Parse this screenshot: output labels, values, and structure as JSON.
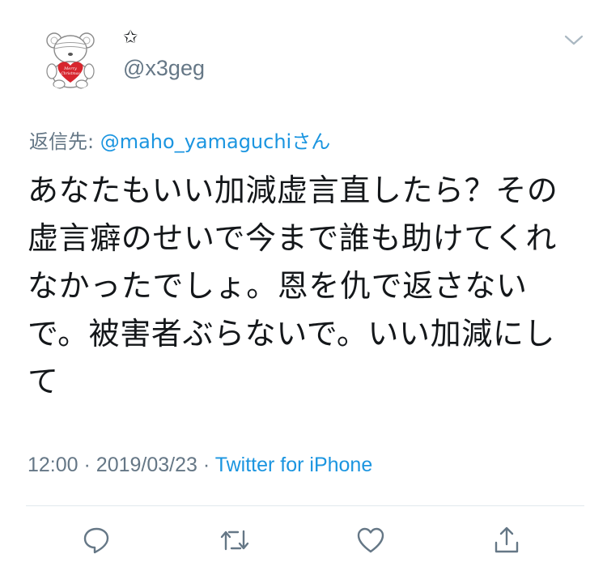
{
  "tweet": {
    "display_name": "✩",
    "handle": "@x3geg",
    "reply_prefix": "返信先: ",
    "reply_mention": "@maho_yamaguchi",
    "reply_suffix": "さん",
    "text": "あなたもいい加減虚言直したら？その虚言癖のせいで今まで誰も助けてくれなかったでしょ。恩を仇で返さないで。被害者ぶらないで。いい加減にして",
    "time": "12:00",
    "separator": "·",
    "date": "2019/03/23",
    "source": "Twitter for iPhone",
    "avatar_heart_text": "Merry Christmas"
  },
  "icons": {
    "menu": "chevron-down-icon",
    "reply": "reply-icon",
    "retweet": "retweet-icon",
    "like": "heart-icon",
    "share": "share-icon"
  },
  "colors": {
    "text": "#14171a",
    "secondary": "#657786",
    "link": "#1b95e0",
    "divider": "#e1e8ed",
    "heart": "#d7262e"
  }
}
